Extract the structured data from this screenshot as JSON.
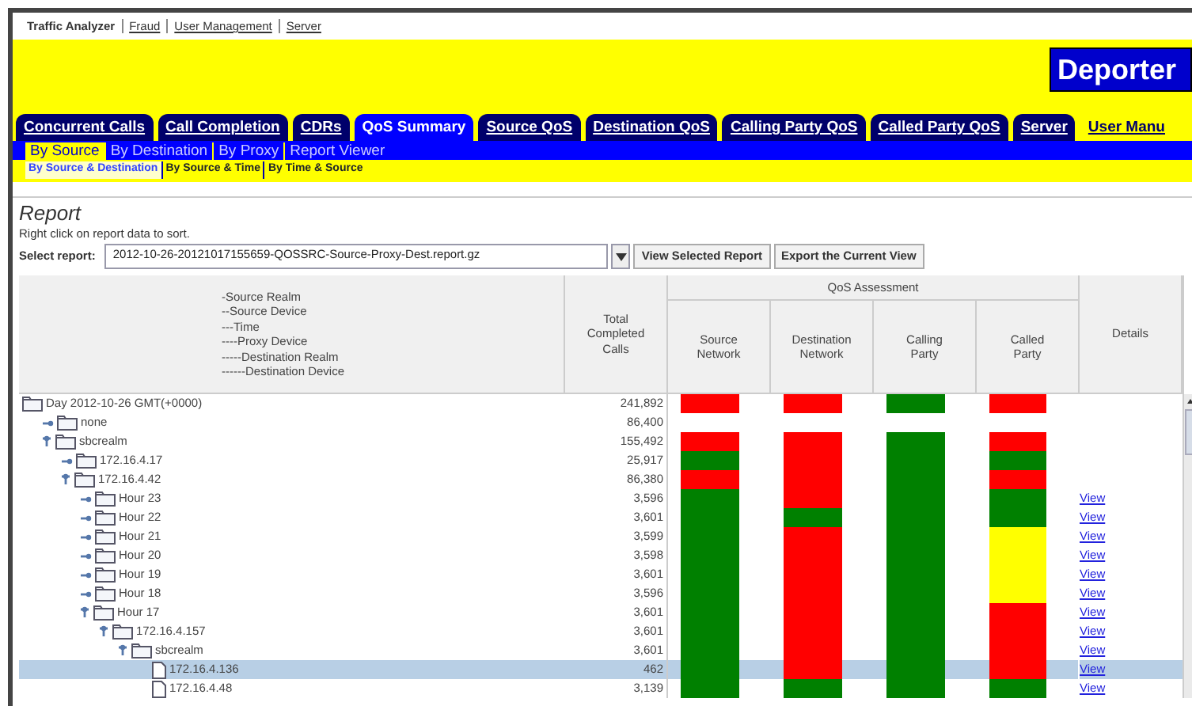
{
  "top_links": [
    {
      "label": "Traffic Analyzer",
      "selected": true
    },
    {
      "label": "Fraud",
      "selected": false
    },
    {
      "label": "User Management",
      "selected": false
    },
    {
      "label": "Server",
      "selected": false
    }
  ],
  "logo": "Deporter",
  "tabs": [
    {
      "label": "Concurrent Calls",
      "selected": false,
      "kind": "tab"
    },
    {
      "label": "Call Completion",
      "selected": false,
      "kind": "tab"
    },
    {
      "label": "CDRs",
      "selected": false,
      "kind": "tab"
    },
    {
      "label": "QoS Summary",
      "selected": true,
      "kind": "tab"
    },
    {
      "label": "Source QoS",
      "selected": false,
      "kind": "tab"
    },
    {
      "label": "Destination QoS",
      "selected": false,
      "kind": "tab"
    },
    {
      "label": "Calling Party QoS",
      "selected": false,
      "kind": "tab"
    },
    {
      "label": "Called Party QoS",
      "selected": false,
      "kind": "tab"
    },
    {
      "label": "Server",
      "selected": false,
      "kind": "tab"
    },
    {
      "label": "User Manu",
      "selected": false,
      "kind": "link"
    }
  ],
  "subtabs": [
    {
      "label": "By Source",
      "selected": true
    },
    {
      "label": "By Destination",
      "selected": false
    },
    {
      "label": "By Proxy",
      "selected": false
    },
    {
      "label": "Report Viewer",
      "selected": false
    }
  ],
  "views": [
    {
      "label": "By Source & Destination",
      "selected": true
    },
    {
      "label": "By Source & Time",
      "selected": false
    },
    {
      "label": "By Time & Source",
      "selected": false
    }
  ],
  "report": {
    "title": "Report",
    "hint": "Right click on report data to sort.",
    "select_label": "Select report:",
    "select_value": "2012-10-26-20121017155659-QOSSRC-Source-Proxy-Dest.report.gz",
    "buttons": [
      "View Selected Report",
      "Export the Current View"
    ]
  },
  "table": {
    "hierarchy": [
      "-Source Realm",
      "--Source Device",
      "---Time",
      "----Proxy Device",
      "-----Destination Realm",
      "------Destination Device"
    ],
    "total_header": [
      "Total",
      "Completed",
      "Calls"
    ],
    "group_header": "QoS Assessment",
    "qos_columns": [
      [
        "Source",
        "Network"
      ],
      [
        "Destination",
        "Network"
      ],
      [
        "Calling",
        "Party"
      ],
      [
        "Called",
        "Party"
      ]
    ],
    "details_header": "Details",
    "rows": [
      {
        "label": "Day 2012-10-26 GMT(+0000)",
        "kind": "folder",
        "total": "241,892",
        "selected": false,
        "qos": [
          {
            "color": "#ff0000"
          },
          {
            "color": "#ff0000"
          },
          {
            "color": "#008000"
          },
          {
            "color": "#ff0000"
          }
        ],
        "children": [
          {
            "label": "none",
            "kind": "folder",
            "expanded": false,
            "total": "86,400",
            "selected": false
          },
          {
            "label": "sbcrealm",
            "kind": "folder",
            "expanded": true,
            "total": "155,492",
            "selected": false,
            "qos": [
              {
                "color": "#ff0000"
              },
              {
                "color": "#ff0000"
              },
              {
                "color": "#008000"
              },
              {
                "color": "#ff0000"
              }
            ],
            "children": [
              {
                "label": "172.16.4.17",
                "kind": "folder",
                "expanded": false,
                "total": "25,917",
                "selected": false,
                "qos": [
                  {
                    "color": "#008000"
                  },
                  {
                    "color": "#ff0000"
                  },
                  {
                    "color": "#008000"
                  },
                  {
                    "color": "#008000"
                  }
                ]
              },
              {
                "label": "172.16.4.42",
                "kind": "folder",
                "expanded": true,
                "total": "86,380",
                "selected": false,
                "qos": [
                  {
                    "color": "#ff0000"
                  },
                  {
                    "color": "#ff0000"
                  },
                  {
                    "color": "#008000"
                  },
                  {
                    "color": "#ff0000"
                  }
                ],
                "children": [
                  {
                    "label": "Hour 23",
                    "kind": "folder",
                    "expanded": false,
                    "total": "3,596",
                    "selected": false,
                    "qos": [
                      {
                        "color": "#008000"
                      },
                      {
                        "color": "#ff0000"
                      },
                      {
                        "color": "#008000"
                      },
                      {
                        "color": "#008000"
                      }
                    ],
                    "details": "View"
                  },
                  {
                    "label": "Hour 22",
                    "kind": "folder",
                    "expanded": false,
                    "total": "3,601",
                    "selected": false,
                    "qos": [
                      {
                        "color": "#008000"
                      },
                      {
                        "color": "#008000"
                      },
                      {
                        "color": "#008000"
                      },
                      {
                        "color": "#008000"
                      }
                    ],
                    "details": "View"
                  },
                  {
                    "label": "Hour 21",
                    "kind": "folder",
                    "expanded": false,
                    "total": "3,599",
                    "selected": false,
                    "qos": [
                      {
                        "color": "#008000"
                      },
                      {
                        "color": "#ff0000"
                      },
                      {
                        "color": "#008000"
                      },
                      {
                        "color": "#ffff00"
                      }
                    ],
                    "details": "View"
                  },
                  {
                    "label": "Hour 20",
                    "kind": "folder",
                    "expanded": false,
                    "total": "3,598",
                    "selected": false,
                    "qos": [
                      {
                        "color": "#008000"
                      },
                      {
                        "color": "#ff0000"
                      },
                      {
                        "color": "#008000"
                      },
                      {
                        "color": "#ffff00"
                      }
                    ],
                    "details": "View"
                  },
                  {
                    "label": "Hour 19",
                    "kind": "folder",
                    "expanded": false,
                    "total": "3,601",
                    "selected": false,
                    "qos": [
                      {
                        "color": "#008000"
                      },
                      {
                        "color": "#ff0000"
                      },
                      {
                        "color": "#008000"
                      },
                      {
                        "color": "#ffff00"
                      }
                    ],
                    "details": "View"
                  },
                  {
                    "label": "Hour 18",
                    "kind": "folder",
                    "expanded": false,
                    "total": "3,596",
                    "selected": false,
                    "qos": [
                      {
                        "color": "#008000"
                      },
                      {
                        "color": "#ff0000"
                      },
                      {
                        "color": "#008000"
                      },
                      {
                        "color": "#ffff00"
                      }
                    ],
                    "details": "View"
                  },
                  {
                    "label": "Hour 17",
                    "kind": "folder",
                    "expanded": true,
                    "total": "3,601",
                    "selected": false,
                    "qos": [
                      {
                        "color": "#008000"
                      },
                      {
                        "color": "#ff0000"
                      },
                      {
                        "color": "#008000"
                      },
                      {
                        "color": "#ff0000"
                      }
                    ],
                    "details": "View",
                    "children": [
                      {
                        "label": "172.16.4.157",
                        "kind": "folder",
                        "expanded": true,
                        "total": "3,601",
                        "selected": false,
                        "qos": [
                          {
                            "color": "#008000"
                          },
                          {
                            "color": "#ff0000"
                          },
                          {
                            "color": "#008000"
                          },
                          {
                            "color": "#ff0000"
                          }
                        ],
                        "details": "View",
                        "children": [
                          {
                            "label": "sbcrealm",
                            "kind": "folder",
                            "expanded": true,
                            "total": "3,601",
                            "selected": false,
                            "qos": [
                              {
                                "color": "#008000"
                              },
                              {
                                "color": "#ff0000"
                              },
                              {
                                "color": "#008000"
                              },
                              {
                                "color": "#ff0000"
                              }
                            ],
                            "details": "View",
                            "children": [
                              {
                                "label": "172.16.4.136",
                                "kind": "file",
                                "total": "462",
                                "selected": true,
                                "qos": [
                                  {
                                    "color": "#008000"
                                  },
                                  {
                                    "color": "#ff0000"
                                  },
                                  {
                                    "color": "#008000"
                                  },
                                  {
                                    "color": "#ff0000"
                                  }
                                ],
                                "details": "View"
                              },
                              {
                                "label": "172.16.4.48",
                                "kind": "file",
                                "total": "3,139",
                                "selected": false,
                                "qos": [
                                  {
                                    "color": "#008000"
                                  },
                                  {
                                    "color": "#008000"
                                  },
                                  {
                                    "color": "#008000"
                                  },
                                  {
                                    "color": "#008000"
                                  }
                                ],
                                "details": "View"
                              }
                            ]
                          }
                        ]
                      }
                    ]
                  }
                ]
              }
            ]
          }
        ]
      }
    ]
  }
}
